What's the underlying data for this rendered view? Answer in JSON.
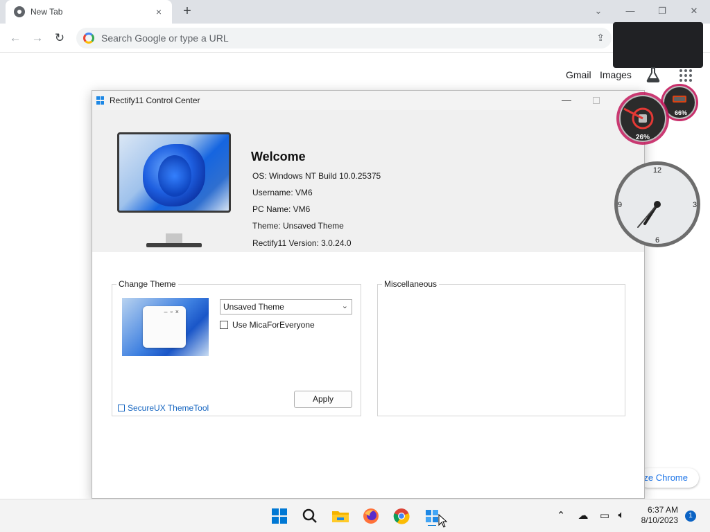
{
  "browser": {
    "tab_title": "New Tab",
    "tab_close": "×",
    "new_tab": "+",
    "omnibox_placeholder": "Search Google or type a URL",
    "ntp_links": [
      "Gmail",
      "Images"
    ],
    "customize_label": "Customize Chrome"
  },
  "rectify": {
    "window_title": "Rectify11 Control Center",
    "welcome": "Welcome",
    "info": [
      "OS: Windows NT Build 10.0.25375",
      "Username: VM6",
      "PC Name: VM6",
      "Theme: Unsaved Theme",
      "Rectify11 Version: 3.0.24.0"
    ],
    "change_theme": {
      "legend": "Change Theme",
      "selected_theme": "Unsaved Theme",
      "mica_label": "Use MicaForEveryone",
      "mica_checked": false,
      "link_label": "SecureUX ThemeTool",
      "apply_label": "Apply"
    },
    "misc": {
      "legend": "Miscellaneous"
    }
  },
  "gadgets": {
    "cpu_percent": 26,
    "cpu_label": "26%",
    "mem_percent": 66,
    "mem_label": "66%",
    "clock_numbers": [
      "12",
      "3",
      "6",
      "9"
    ],
    "clock_time": "6:37"
  },
  "taskbar": {
    "time": "6:37 AM",
    "date": "8/10/2023",
    "notification_count": "1",
    "apps": [
      "start-icon",
      "search-icon",
      "file-explorer-icon",
      "firefox-icon",
      "chrome-icon",
      "rectify11-icon"
    ]
  },
  "colors": {
    "accent": "#1e88e5",
    "link": "#1565c0",
    "gauge_red": "#e53935"
  }
}
